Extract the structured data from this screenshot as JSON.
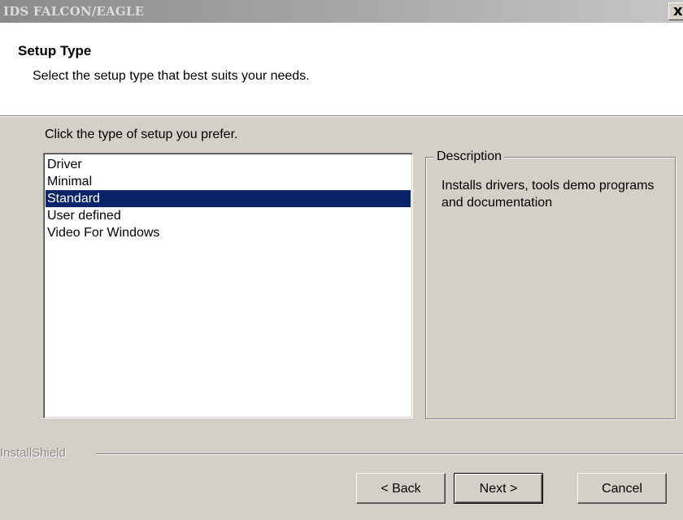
{
  "window": {
    "title": "IDS FALCON/EAGLE",
    "close_label": "x"
  },
  "header": {
    "title": "Setup Type",
    "subtitle": "Select the setup type that best suits your needs."
  },
  "main": {
    "prompt": "Click the type of setup you prefer.",
    "setup_types": [
      "Driver",
      "Minimal",
      "Standard",
      "User defined",
      "Video For Windows"
    ],
    "selected_type": "Standard",
    "description": {
      "legend": "Description",
      "text": "Installs drivers, tools demo programs and documentation"
    }
  },
  "footer": {
    "brand": "InstallShield",
    "back_label": "< Back",
    "next_label": "Next >",
    "cancel_label": "Cancel"
  },
  "colors": {
    "dialog_bg": "#d4d0c8",
    "selection_bg": "#0a246a",
    "selection_fg": "#ffffff"
  }
}
